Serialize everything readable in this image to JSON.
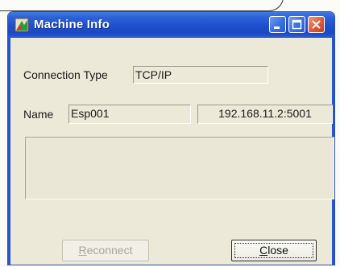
{
  "window": {
    "title": "Machine Info",
    "accent_color": "#1f4fcc",
    "close_color": "#dd5a3a"
  },
  "controls": {
    "minimize_icon": "minimize-icon",
    "maximize_icon": "maximize-icon",
    "close_icon": "close-icon"
  },
  "form": {
    "connection_type_label": "Connection Type",
    "connection_type_value": "TCP/IP",
    "name_label": "Name",
    "name_value": "Esp001",
    "address_value": "192.168.11.2:5001",
    "details_text": ""
  },
  "buttons": {
    "reconnect_mnemonic": "R",
    "reconnect_rest": "econnect",
    "reconnect_disabled": true,
    "close_mnemonic": "C",
    "close_rest": "lose"
  }
}
